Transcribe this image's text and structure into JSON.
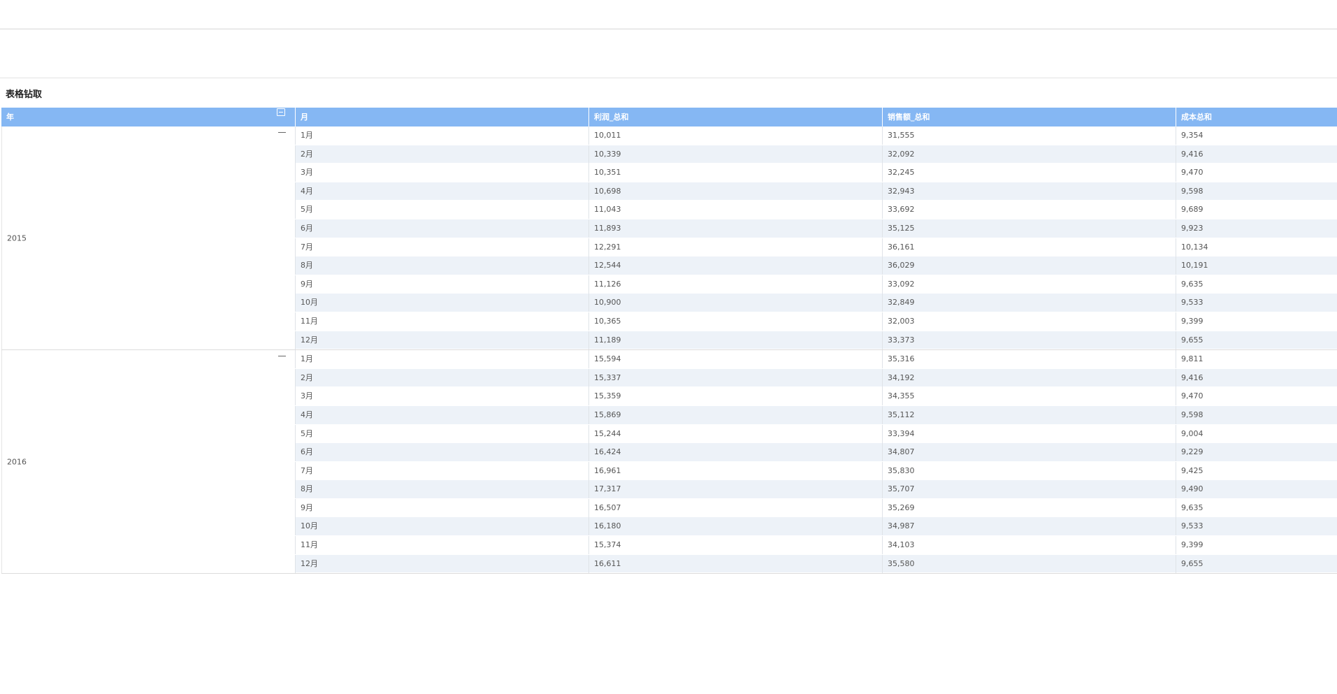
{
  "widget": {
    "title": "表格钻取"
  },
  "table": {
    "columns": [
      "年",
      "月",
      "利润_总和",
      "销售额_总和",
      "成本总和"
    ],
    "groups": [
      {
        "year": "2015",
        "rows": [
          {
            "month": "1月",
            "profit": "10,011",
            "sales": "31,555",
            "cost": "9,354"
          },
          {
            "month": "2月",
            "profit": "10,339",
            "sales": "32,092",
            "cost": "9,416"
          },
          {
            "month": "3月",
            "profit": "10,351",
            "sales": "32,245",
            "cost": "9,470"
          },
          {
            "month": "4月",
            "profit": "10,698",
            "sales": "32,943",
            "cost": "9,598"
          },
          {
            "month": "5月",
            "profit": "11,043",
            "sales": "33,692",
            "cost": "9,689"
          },
          {
            "month": "6月",
            "profit": "11,893",
            "sales": "35,125",
            "cost": "9,923"
          },
          {
            "month": "7月",
            "profit": "12,291",
            "sales": "36,161",
            "cost": "10,134"
          },
          {
            "month": "8月",
            "profit": "12,544",
            "sales": "36,029",
            "cost": "10,191"
          },
          {
            "month": "9月",
            "profit": "11,126",
            "sales": "33,092",
            "cost": "9,635"
          },
          {
            "month": "10月",
            "profit": "10,900",
            "sales": "32,849",
            "cost": "9,533"
          },
          {
            "month": "11月",
            "profit": "10,365",
            "sales": "32,003",
            "cost": "9,399"
          },
          {
            "month": "12月",
            "profit": "11,189",
            "sales": "33,373",
            "cost": "9,655"
          }
        ]
      },
      {
        "year": "2016",
        "rows": [
          {
            "month": "1月",
            "profit": "15,594",
            "sales": "35,316",
            "cost": "9,811"
          },
          {
            "month": "2月",
            "profit": "15,337",
            "sales": "34,192",
            "cost": "9,416"
          },
          {
            "month": "3月",
            "profit": "15,359",
            "sales": "34,355",
            "cost": "9,470"
          },
          {
            "month": "4月",
            "profit": "15,869",
            "sales": "35,112",
            "cost": "9,598"
          },
          {
            "month": "5月",
            "profit": "15,244",
            "sales": "33,394",
            "cost": "9,004"
          },
          {
            "month": "6月",
            "profit": "16,424",
            "sales": "34,807",
            "cost": "9,229"
          },
          {
            "month": "7月",
            "profit": "16,961",
            "sales": "35,830",
            "cost": "9,425"
          },
          {
            "month": "8月",
            "profit": "17,317",
            "sales": "35,707",
            "cost": "9,490"
          },
          {
            "month": "9月",
            "profit": "16,507",
            "sales": "35,269",
            "cost": "9,635"
          },
          {
            "month": "10月",
            "profit": "16,180",
            "sales": "34,987",
            "cost": "9,533"
          },
          {
            "month": "11月",
            "profit": "15,374",
            "sales": "34,103",
            "cost": "9,399"
          },
          {
            "month": "12月",
            "profit": "16,611",
            "sales": "35,580",
            "cost": "9,655"
          }
        ]
      }
    ]
  },
  "colors": {
    "header_bg": "#85b7f3",
    "row_alt_bg": "#edf2f8"
  },
  "icons": {
    "collapse_all": "collapse-all-icon",
    "group_collapse": "collapse-icon"
  }
}
